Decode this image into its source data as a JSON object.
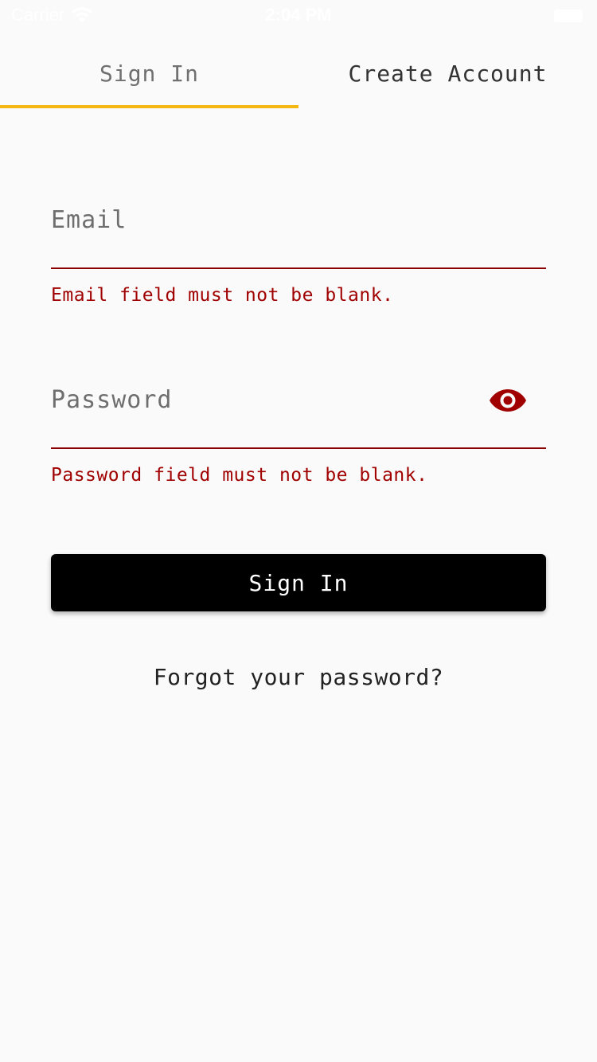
{
  "status_bar": {
    "carrier": "Carrier",
    "time": "2:04 PM",
    "wifi_icon": "wifi-icon",
    "battery_icon": "battery-icon"
  },
  "tabs": [
    {
      "label": "Sign In",
      "active": true
    },
    {
      "label": "Create Account",
      "active": false
    }
  ],
  "form": {
    "email": {
      "placeholder": "Email",
      "value": "",
      "error": "Email field must not be blank."
    },
    "password": {
      "placeholder": "Password",
      "value": "",
      "error": "Password field must not be blank.",
      "toggle_icon": "eye-icon"
    },
    "submit_label": "Sign In",
    "forgot_label": "Forgot your password?"
  },
  "colors": {
    "accent": "#f5b812",
    "error": "#a00000",
    "underline": "#8b0000",
    "button_bg": "#000000",
    "background": "#fafafa"
  }
}
